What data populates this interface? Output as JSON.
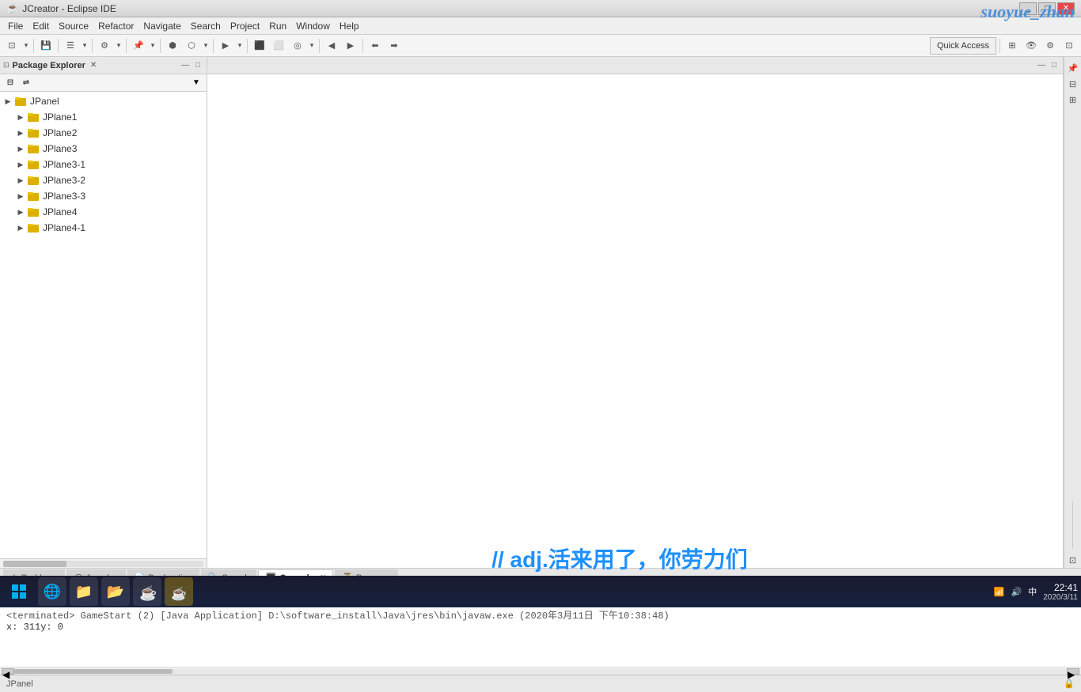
{
  "window": {
    "title": "JCreator - Eclipse IDE",
    "icon": "☕",
    "watermark": "suoyue_zhan"
  },
  "menu": {
    "items": [
      "File",
      "Edit",
      "Source",
      "Refactor",
      "Navigate",
      "Search",
      "Project",
      "Run",
      "Window",
      "Help"
    ]
  },
  "toolbar": {
    "quick_access_label": "Quick Access",
    "buttons": [
      "⊡",
      "💾",
      "⎘",
      "◀",
      "▶"
    ]
  },
  "sidebar": {
    "title": "Package Explorer",
    "close_icon": "✕",
    "min_icon": "—",
    "max_icon": "□",
    "collapse_all": "⊟",
    "link_with_editor": "⇌",
    "view_menu": "▼",
    "items": [
      {
        "id": "jpanel",
        "label": "JPanel",
        "level": 0,
        "expanded": true,
        "icon": "📁"
      },
      {
        "id": "jplane1",
        "label": "JPlane1",
        "level": 1,
        "expanded": false,
        "icon": "📁"
      },
      {
        "id": "jplane2",
        "label": "JPlane2",
        "level": 1,
        "expanded": false,
        "icon": "📁"
      },
      {
        "id": "jplane3",
        "label": "JPlane3",
        "level": 1,
        "expanded": false,
        "icon": "📁"
      },
      {
        "id": "jplane3-1",
        "label": "JPlane3-1",
        "level": 1,
        "expanded": false,
        "icon": "📁"
      },
      {
        "id": "jplane3-2",
        "label": "JPlane3-2",
        "level": 1,
        "expanded": false,
        "icon": "📁"
      },
      {
        "id": "jplane3-3",
        "label": "JPlane3-3",
        "level": 1,
        "expanded": false,
        "icon": "📁"
      },
      {
        "id": "jplane4",
        "label": "JPlane4",
        "level": 1,
        "expanded": false,
        "icon": "📁"
      },
      {
        "id": "jplane4-1",
        "label": "JPlane4-1",
        "level": 1,
        "expanded": false,
        "icon": "📁"
      }
    ]
  },
  "editor": {
    "min_icon": "—",
    "max_icon": "□"
  },
  "bottom_panel": {
    "tabs": [
      {
        "id": "problems",
        "label": "Problems",
        "icon": "⚠"
      },
      {
        "id": "javadoc",
        "label": "Javadoc",
        "icon": "@"
      },
      {
        "id": "declaration",
        "label": "Declaration",
        "icon": "📄"
      },
      {
        "id": "search",
        "label": "Search",
        "icon": "🔍"
      },
      {
        "id": "console",
        "label": "Console",
        "icon": "🖥",
        "active": true
      },
      {
        "id": "progress",
        "label": "Progress",
        "icon": "⏳"
      }
    ],
    "console": {
      "terminated_line": "<terminated> GameStart (2) [Java Application] D:\\software_install\\Java\\jres\\bin\\javaw.exe (2020年3月11日 下午10:38:48)",
      "output_line": "x: 311y: 0"
    },
    "toolbar_buttons_left": [
      "■",
      "✕",
      "✕✕",
      "⋮⋮",
      "≡≡",
      "📋",
      "📄",
      "🔽",
      "🔼"
    ],
    "toolbar_buttons_right": [
      "↩",
      "⬇",
      "⬇⬇",
      "↗",
      "⬛",
      "⬜"
    ],
    "min_icon": "—",
    "max_icon": "□"
  },
  "status_bar": {
    "left": "JPanel",
    "right_icon": "🔒"
  },
  "taskbar": {
    "start_icon": "⊞",
    "time": "22:41",
    "date": "2020/3/11",
    "icons": [
      "⊞",
      "🌐",
      "📁",
      "📂",
      "💻",
      "☕"
    ],
    "chinese_text": "// adj.活来用了，你劳力们"
  },
  "right_sidebar": {
    "buttons": [
      "📌",
      "⊟",
      "⊞"
    ]
  }
}
